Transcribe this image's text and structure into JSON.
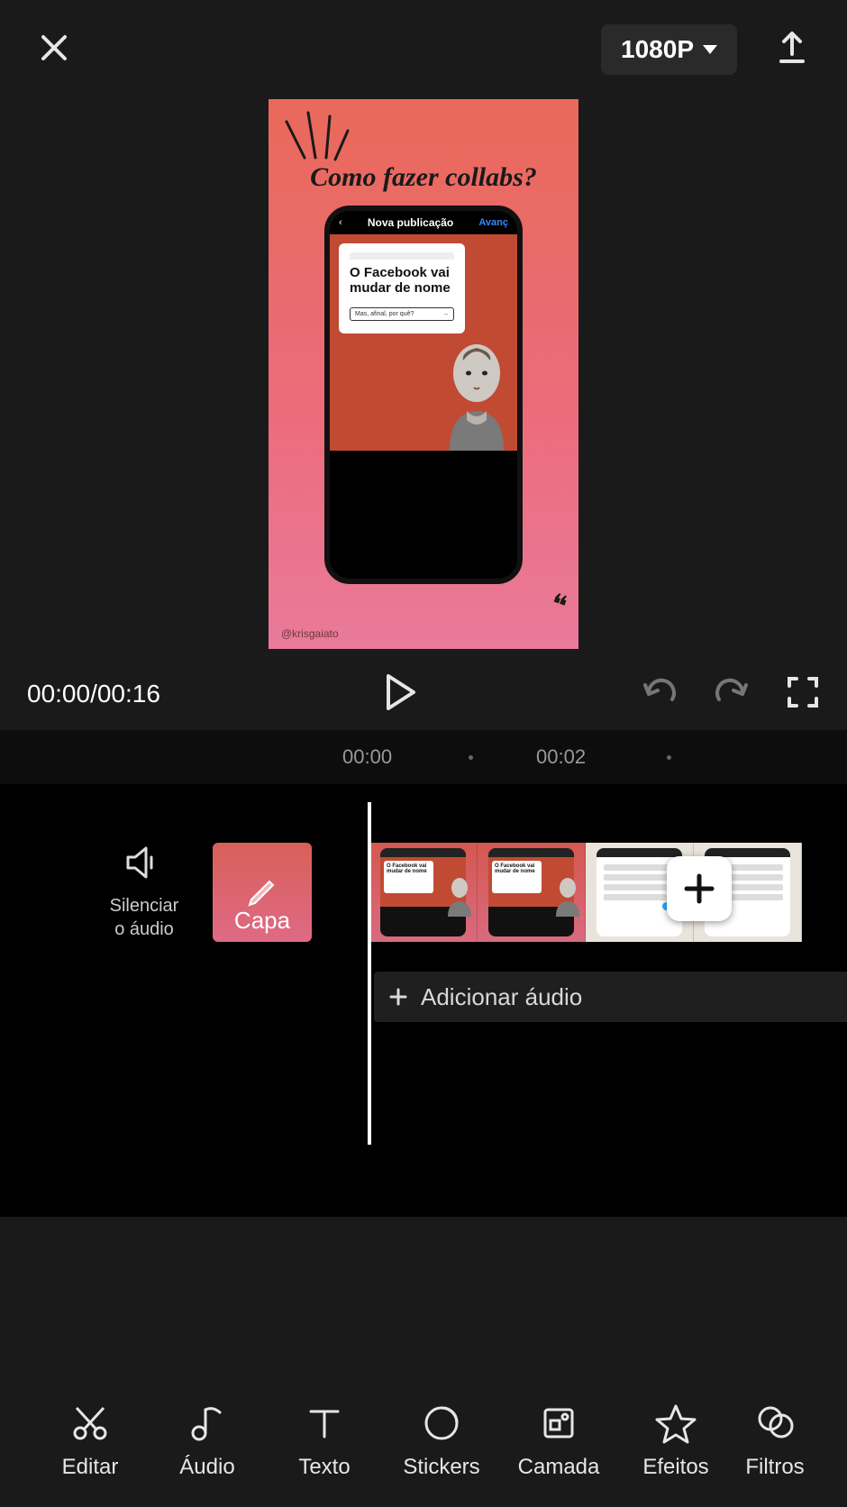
{
  "topbar": {
    "resolution": "1080P"
  },
  "preview": {
    "script_title": "Como fazer collabs?",
    "phone_header": {
      "back": "‹",
      "title": "Nova publicação",
      "next": "Avanç"
    },
    "card_heading": "O Facebook vai mudar de nome",
    "card_sub": "Mas, afinal, por quê?",
    "handle": "@krisgaiato"
  },
  "playback": {
    "current": "00:00",
    "total": "00:16"
  },
  "ruler": {
    "mark0": "00:00",
    "mark2": "00:02"
  },
  "timeline": {
    "mute_label_l1": "Silenciar",
    "mute_label_l2": "o áudio",
    "cover_label": "Capa",
    "clip_card_text": "O Facebook vai mudar de nome",
    "add_audio": "Adicionar áudio"
  },
  "toolbar": {
    "edit": "Editar",
    "audio": "Áudio",
    "text": "Texto",
    "stickers": "Stickers",
    "layer": "Camada",
    "effects": "Efeitos",
    "filters": "Filtros"
  }
}
